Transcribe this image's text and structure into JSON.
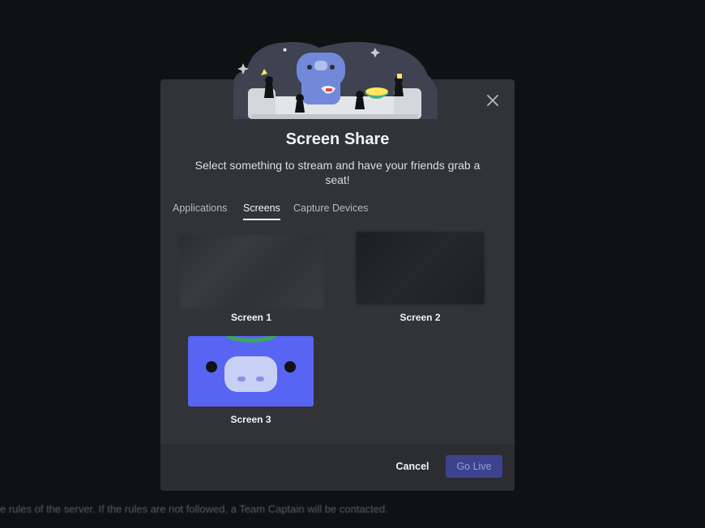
{
  "background": {
    "faint_text": "",
    "rules_text": "e rules of the server. If the rules are not followed, a Team Captain will be contacted."
  },
  "modal": {
    "title": "Screen Share",
    "subtitle": "Select something to stream and have your friends grab a seat!",
    "tabs": [
      {
        "label": "Applications",
        "active": false
      },
      {
        "label": "Screens",
        "active": true
      },
      {
        "label": "Capture Devices",
        "active": false
      }
    ],
    "screens": [
      {
        "label": "Screen 1"
      },
      {
        "label": "Screen 2"
      },
      {
        "label": "Screen 3"
      }
    ],
    "footer": {
      "cancel_label": "Cancel",
      "go_live_label": "Go Live"
    }
  },
  "colors": {
    "backdrop": "#101113",
    "modal_bg": "#313338",
    "footer_bg": "#2b2d31",
    "blurple": "#5865f2",
    "go_live_disabled": "#3c428d"
  },
  "icons": {
    "close": "close-icon"
  }
}
